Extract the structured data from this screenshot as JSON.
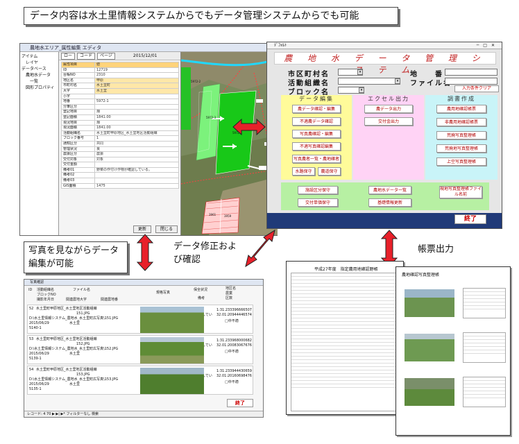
{
  "callouts": {
    "top": "データ内容は水土里情報システムからでもデータ管理システムからでも可能",
    "photo_note": "写真を見ながらデータ編集が可能",
    "correction": "データ修正および確認",
    "report": "帳票出力"
  },
  "gis": {
    "title": "農地水エリア_属性編集 エディタ",
    "tree": [
      "アイテム",
      "レイヤ",
      "データベース",
      "農地水データ",
      "一覧",
      "図形プロパティ"
    ],
    "nav": [
      "ロー",
      "コード",
      "ページ",
      "2015/12/01"
    ],
    "fields": [
      {
        "k": "属性項目",
        "v": "値"
      },
      {
        "k": "ID",
        "v": "12719"
      },
      {
        "k": "台帳NO",
        "v": "2310"
      },
      {
        "k": "地区名",
        "v": "甲原"
      },
      {
        "k": "市町村名",
        "v": "水土里町"
      },
      {
        "k": "大字",
        "v": "水土里"
      },
      {
        "k": "小字",
        "v": ""
      },
      {
        "k": "地番",
        "v": "5972-1"
      },
      {
        "k": "分筆区分",
        "v": ""
      },
      {
        "k": "登記地目",
        "v": "畑"
      },
      {
        "k": "登記面積",
        "v": "1841.00"
      },
      {
        "k": "現況地目",
        "v": "畑"
      },
      {
        "k": "現況面積",
        "v": "1841.00"
      },
      {
        "k": "活動組織名",
        "v": "水土里町甲原地区_水土里地区活動組織"
      },
      {
        "k": "ブロック番号",
        "v": "1"
      },
      {
        "k": "通知区分",
        "v": "共同"
      },
      {
        "k": "管理状況",
        "v": "良"
      },
      {
        "k": "農振区分",
        "v": "農振"
      },
      {
        "k": "交付対象",
        "v": "対象"
      },
      {
        "k": "交付金額",
        "v": ""
      },
      {
        "k": "備考01",
        "v": "野菜の作付け作物が確認している。"
      },
      {
        "k": "備考02",
        "v": ""
      },
      {
        "k": "備考03",
        "v": ""
      },
      {
        "k": "GIS面積",
        "v": "1475"
      }
    ],
    "buttons": [
      "更新",
      "閉じる"
    ],
    "parcels": [
      "5972-3",
      "5972-1",
      "5972-2",
      "3961",
      "3959"
    ]
  },
  "mgmt": {
    "window_title": "ﾃﾞﾌｫﾙﾄ",
    "title": "農 地 水 デ ー タ 管 理 シ ス テ ム",
    "fields": {
      "city": "市区町村名",
      "org": "活動組織名",
      "block": "ブロック名",
      "chiban": "地　　番",
      "file": "ファイル名"
    },
    "clear_button": "入力条件クリア",
    "panels": {
      "edit": {
        "title": "データ編集",
        "buttons": [
          "農データ確認・編集",
          "不適農データ確認",
          "写真農確認・編集",
          "不適写真確認編集",
          "写真農者一覧・農地確者",
          "水路保守",
          "農道保守"
        ]
      },
      "excel": {
        "title": "エクセル出力",
        "buttons": [
          "農データ出力",
          "交付金出力"
        ]
      },
      "report": {
        "title": "調書作成",
        "buttons": [
          "農用地確認帳票",
          "非農用地確認帳票",
          "荒廃写真整理帳",
          "荒廃地写真整理帳",
          "上空写真整理帳"
        ]
      }
    },
    "bottom_buttons": [
      "施設区分保守",
      "交付単価保守",
      "農地水データ一覧",
      "基礎情報更新",
      "現地写真整理帳ファイル名前"
    ],
    "end": "終了"
  },
  "photo": {
    "title": "写真確認",
    "headers": [
      "ID",
      "活動組織名",
      "ブロックNO",
      "ファイル名",
      "撮影年月日",
      "関連農地大字",
      "関連農地番",
      "規格写真",
      "保全状況",
      "備考",
      "地区名",
      "農業",
      "区数"
    ],
    "records": [
      {
        "id": "52",
        "org": "水土里町甲原地区_水土里地区活動組織",
        "file": "151.JPG",
        "path": "D:\\水土里情報システム_農地水_水土里町広写真\\151.JPG",
        "date": "2015/06/29",
        "oaza": "水土里",
        "chiban": "5140-1",
        "status": "良",
        "note": "雑草が繁茂している。",
        "area": "1:31.233396666507",
        "area2": "32.01:20944446574",
        "chk": "□中不適"
      },
      {
        "id": "53",
        "org": "水土里町甲原地区_水土里地区活動組織",
        "file": "152.JPG",
        "path": "D:\\水土里情報システム_農地水_水土里町広写真\\152.JPG",
        "date": "2015/06/29",
        "oaza": "水土里",
        "chiban": "5139-1",
        "status": "良",
        "note": "雑草が繁茂している。",
        "area": "1:31.233968000682",
        "area2": "32.01:20083067676",
        "chk": "□中不適"
      },
      {
        "id": "54",
        "org": "水土里町甲原地区_水土里地区活動組織",
        "file": "153.JPG",
        "path": "D:\\水土里情報システム_農地水_水土里町広写真\\153.JPG",
        "date": "2015/06/29",
        "oaza": "水土里",
        "chiban": "5135-1",
        "status": "良",
        "note": "雑草が繁茂している。",
        "area": "1:31.233944430659",
        "area2": "32.01:20160698476",
        "chk": "□中不適"
      }
    ],
    "end": "終了",
    "statusbar": "レコード: 4 70 ▶ ▶| ▶* フィルターなし 検索"
  },
  "reports": {
    "page1_title": "平成27年度　指定農用地確認野帳",
    "page2_title": "農地確認写真整理帳"
  }
}
